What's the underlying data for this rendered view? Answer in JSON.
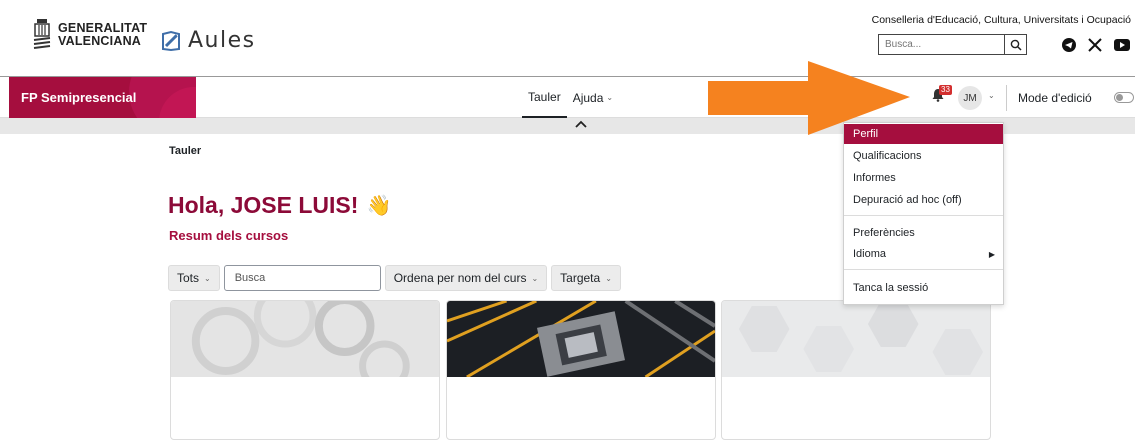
{
  "header": {
    "gva_line1": "GENERALITAT",
    "gva_line2": "VALENCIANA",
    "app_name": "Aules",
    "conselleria": "Conselleria d'Educació, Cultura, Universitats i Ocupació",
    "search_placeholder": "Busca...",
    "social_icons": [
      "telegram-icon",
      "x-icon",
      "youtube-icon"
    ]
  },
  "navbar": {
    "brand": "FP Semipresencial",
    "links": [
      {
        "label": "Tauler",
        "active": true
      },
      {
        "label": "Ajuda",
        "has_dropdown": true
      }
    ],
    "notification_count": "33",
    "avatar_initials": "JM",
    "edit_mode_label": "Mode d'edició",
    "edit_mode_on": false
  },
  "page": {
    "breadcrumb": "Tauler",
    "greeting": "Hola, JOSE LUIS!",
    "greeting_emoji": "👋",
    "section_title": "Resum dels cursos"
  },
  "filters": {
    "grouping": "Tots",
    "search_placeholder": "Busca",
    "sort": "Ordena per nom del curs",
    "view": "Targeta"
  },
  "user_menu": {
    "items": [
      {
        "label": "Perfil",
        "active": true
      },
      {
        "label": "Qualificacions"
      },
      {
        "label": "Informes"
      },
      {
        "label": "Depuració ad hoc (off)"
      },
      {
        "label": "Preferències"
      },
      {
        "label": "Idioma",
        "submenu": true
      },
      {
        "label": "Tanca la sessió"
      }
    ]
  },
  "colors": {
    "brand": "#a50e3e",
    "greeting": "#8c0a38",
    "annotation_arrow": "#f5821f",
    "notification_badge": "#d32f2f"
  }
}
